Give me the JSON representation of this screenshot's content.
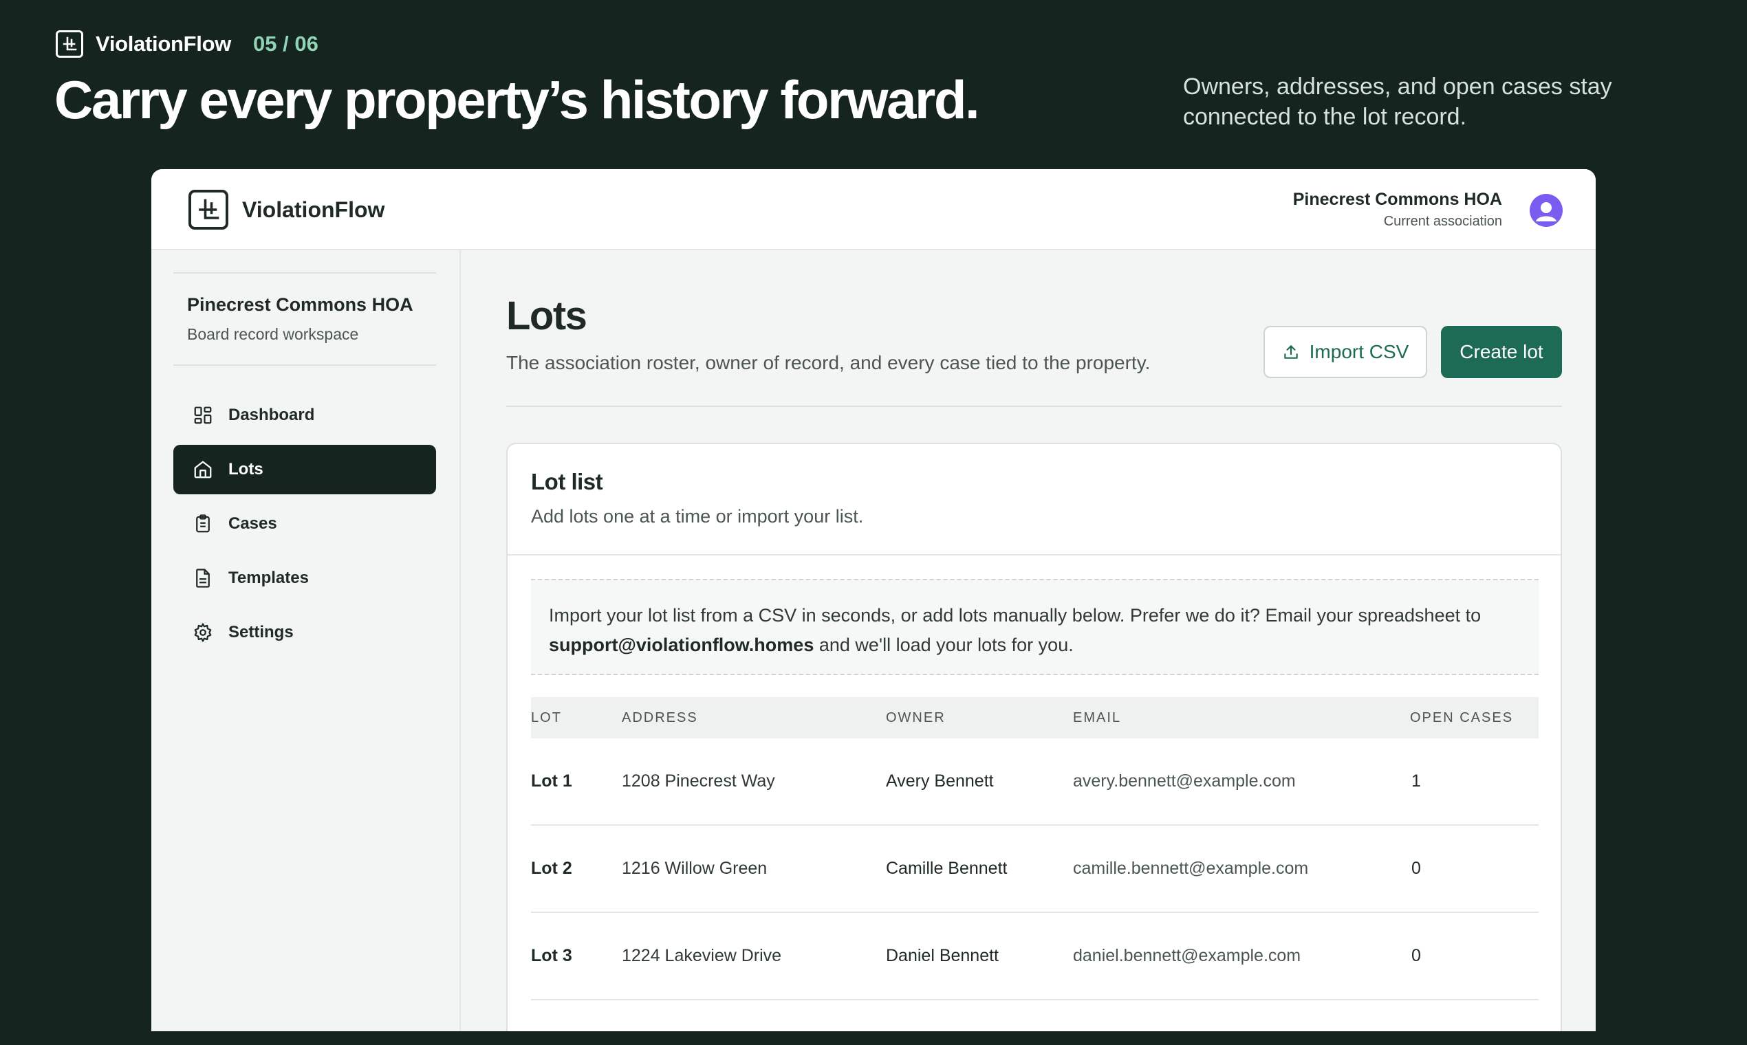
{
  "hero": {
    "brand": "ViolationFlow",
    "step": "05 / 06",
    "title": "Carry every property’s history forward.",
    "subtitle": "Owners, addresses, and open cases stay connected to the lot record."
  },
  "topbar": {
    "brand": "ViolationFlow",
    "association_name": "Pinecrest Commons HOA",
    "association_role": "Current association"
  },
  "sidebar": {
    "workspace_name": "Pinecrest Commons HOA",
    "workspace_sub": "Board record workspace",
    "items": [
      {
        "label": "Dashboard",
        "icon": "dashboard-icon",
        "active": false
      },
      {
        "label": "Lots",
        "icon": "home-icon",
        "active": true
      },
      {
        "label": "Cases",
        "icon": "clipboard-icon",
        "active": false
      },
      {
        "label": "Templates",
        "icon": "document-icon",
        "active": false
      },
      {
        "label": "Settings",
        "icon": "gear-icon",
        "active": false
      }
    ]
  },
  "main": {
    "title": "Lots",
    "subtitle": "The association roster, owner of record, and every case tied to the property.",
    "import_label": "Import CSV",
    "create_label": "Create lot",
    "card": {
      "title": "Lot list",
      "subtitle": "Add lots one at a time or import your list.",
      "notice_prefix": "Import your lot list from a CSV in seconds, or add lots manually below. Prefer we do it? Email your spreadsheet to",
      "notice_email": "support@violationflow.homes",
      "notice_suffix": "and we'll load your lots for you."
    },
    "table": {
      "columns": [
        "LOT",
        "ADDRESS",
        "OWNER",
        "EMAIL",
        "OPEN CASES"
      ],
      "rows": [
        {
          "lot": "Lot 1",
          "address": "1208 Pinecrest Way",
          "owner": "Avery Bennett",
          "email": "avery.bennett@example.com",
          "open_cases": "1"
        },
        {
          "lot": "Lot 2",
          "address": "1216 Willow Green",
          "owner": "Camille Bennett",
          "email": "camille.bennett@example.com",
          "open_cases": "0"
        },
        {
          "lot": "Lot 3",
          "address": "1224 Lakeview Drive",
          "owner": "Daniel Bennett",
          "email": "daniel.bennett@example.com",
          "open_cases": "0"
        }
      ]
    }
  },
  "colors": {
    "background": "#15241f",
    "accent": "#1e6b55",
    "step_accent": "#8fd4b5",
    "avatar": "#7a5cf0"
  }
}
